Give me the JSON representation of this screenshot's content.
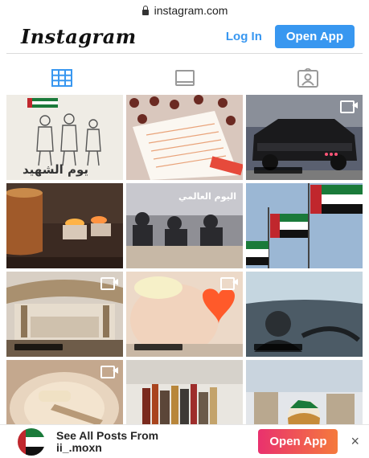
{
  "browser": {
    "url": "instagram.com"
  },
  "header": {
    "logo": "Instagram",
    "login_label": "Log In",
    "open_app_label": "Open App"
  },
  "tabs": [
    {
      "name": "grid",
      "icon": "grid-icon",
      "active": true
    },
    {
      "name": "igtv",
      "icon": "igtv-icon",
      "active": false
    },
    {
      "name": "tagged",
      "icon": "tagged-icon",
      "active": false
    }
  ],
  "posts": [
    {
      "kind": "image",
      "overlay_text": "يوم الشهيد"
    },
    {
      "kind": "image"
    },
    {
      "kind": "reel"
    },
    {
      "kind": "image"
    },
    {
      "kind": "image",
      "overlay_text": "اليوم العالمي"
    },
    {
      "kind": "image"
    },
    {
      "kind": "reel"
    },
    {
      "kind": "reel"
    },
    {
      "kind": "image"
    },
    {
      "kind": "reel"
    },
    {
      "kind": "image"
    },
    {
      "kind": "image"
    }
  ],
  "banner": {
    "line1": "See All Posts From",
    "line2": "ii_.moxn",
    "open_app_label": "Open App",
    "close_glyph": "×"
  },
  "colors": {
    "accent": "#3897f0",
    "active_tab": "#3897f0",
    "gradient_start": "#e9316e",
    "gradient_end": "#f57a3c"
  }
}
